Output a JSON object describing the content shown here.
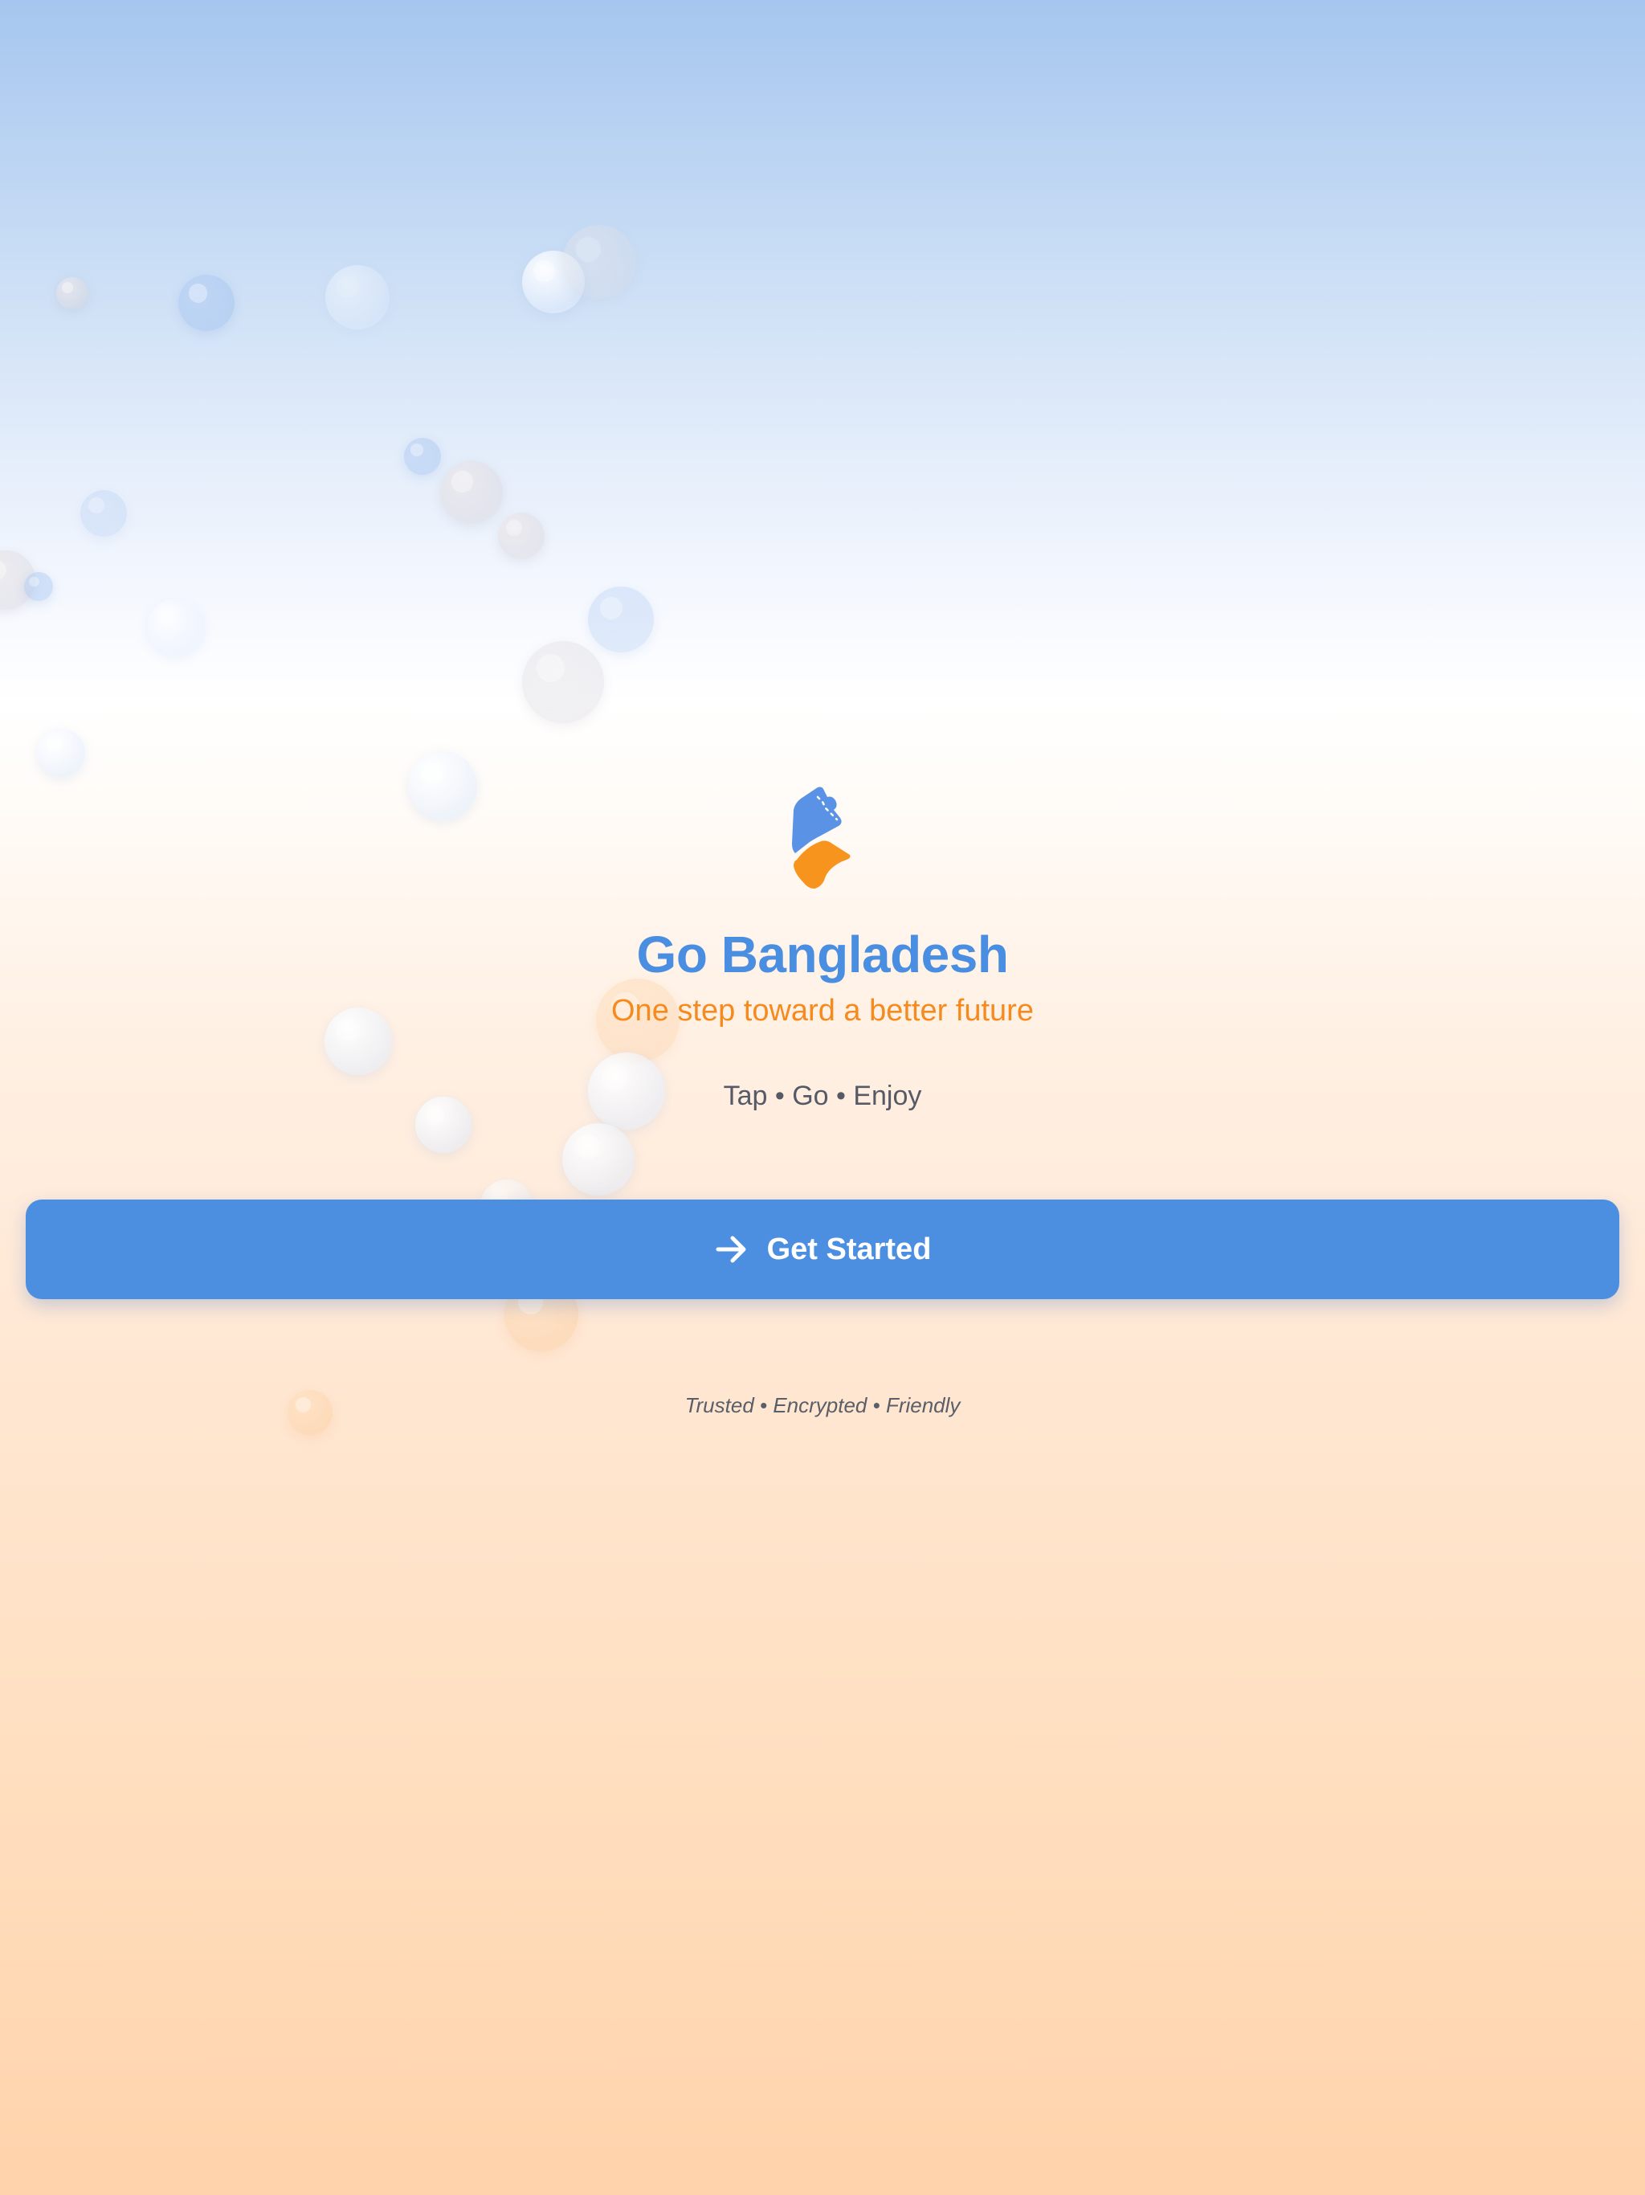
{
  "app": {
    "title": "Go Bangladesh",
    "tagline": "One step toward a better future",
    "slogan": "Tap • Go • Enjoy",
    "footer_note": "Trusted • Encrypted • Friendly"
  },
  "cta": {
    "label": "Get Started",
    "icon": "arrow-right-icon"
  },
  "logo": {
    "icon": "bangladesh-map-logo",
    "colors": [
      "#5a92e6",
      "#f7941d"
    ]
  },
  "colors": {
    "primary": "#4c8fe1",
    "accent": "#f58a1f",
    "text_secondary": "#555a66",
    "background_top": "#a6c6ef",
    "background_bottom": "#ffd3ab"
  }
}
